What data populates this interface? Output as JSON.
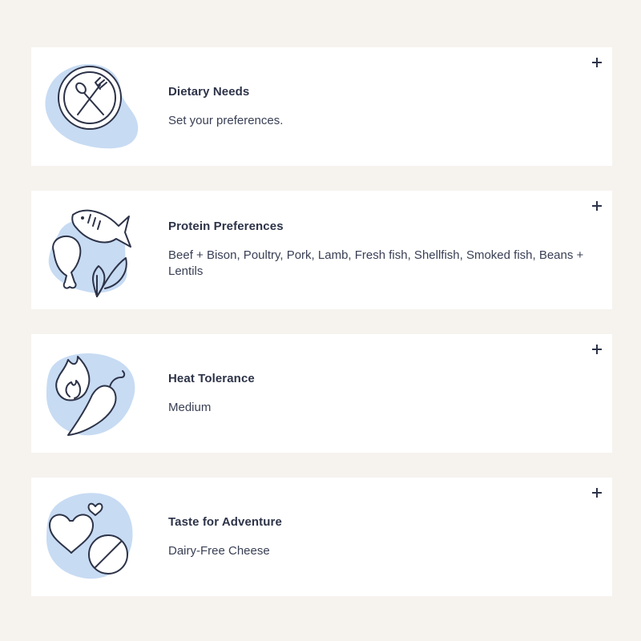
{
  "cards": [
    {
      "title": "Dietary Needs",
      "description": "Set your preferences.",
      "icon": "plate-utensils-icon"
    },
    {
      "title": "Protein Preferences",
      "description": "Beef + Bison, Poultry, Pork, Lamb, Fresh fish, Shellfish, Smoked fish, Beans + Lentils",
      "icon": "fish-drumstick-leaf-icon"
    },
    {
      "title": "Heat Tolerance",
      "description": "Medium",
      "icon": "flame-pepper-icon"
    },
    {
      "title": "Taste for Adventure",
      "description": "Dairy-Free Cheese",
      "icon": "hearts-pill-icon"
    }
  ],
  "colors": {
    "background": "#f6f3ef",
    "card": "#ffffff",
    "accent_blob": "#c7dbf3",
    "text": "#2d3348"
  },
  "expand_icon": "plus-icon"
}
